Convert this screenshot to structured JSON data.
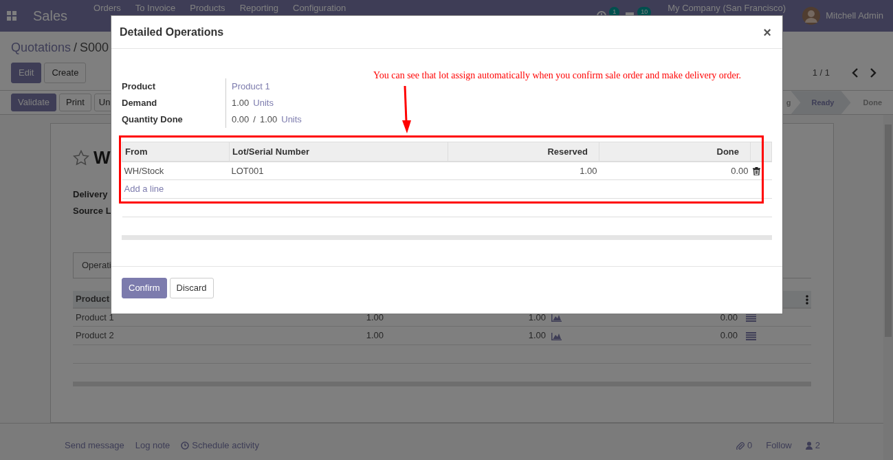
{
  "navbar": {
    "app_title": "Sales",
    "menu": [
      "Orders",
      "To Invoice",
      "Products",
      "Reporting",
      "Configuration"
    ],
    "activity_count": "1",
    "message_count": "10",
    "company": "My Company (San Francisco)",
    "user": "Mitchell Admin"
  },
  "breadcrumb": {
    "parent": "Quotations",
    "separator": "/",
    "current": "S000"
  },
  "control_buttons": [
    {
      "label": "Edit",
      "kind": "primary"
    },
    {
      "label": "Create",
      "kind": "secondary"
    }
  ],
  "pager": "1 / 1",
  "action_buttons": [
    {
      "label": "Validate",
      "kind": "primary"
    },
    {
      "label": "Print",
      "kind": "secondary"
    },
    {
      "label": "Un",
      "kind": "secondary"
    }
  ],
  "status_steps": [
    {
      "label": "g",
      "selected": false
    },
    {
      "label": "Ready",
      "selected": true
    },
    {
      "label": "Done",
      "selected": false
    }
  ],
  "sheet": {
    "starred": false,
    "title": "W",
    "fields": [
      "Delivery",
      "Source L"
    ],
    "tab": "Operati",
    "table": {
      "columns": [
        "Product"
      ],
      "rows": [
        {
          "product": "Product 1",
          "demand": "1.00",
          "reserved": "1.00",
          "done": "0.00"
        },
        {
          "product": "Product 2",
          "demand": "1.00",
          "reserved": "1.00",
          "done": "0.00"
        }
      ]
    }
  },
  "chatter": {
    "actions": [
      "Send message",
      "Log note",
      "Schedule activity"
    ],
    "attachments": "0",
    "follow": "Follow",
    "followers": "2"
  },
  "dialog": {
    "title": "Detailed Operations",
    "close": "×",
    "annotation": "You can see that lot assign automatically when you confirm sale order and make delivery order.",
    "fields": [
      {
        "label": "Product",
        "parts": [
          {
            "text": "Product 1",
            "kind": "link"
          }
        ]
      },
      {
        "label": "Demand",
        "parts": [
          {
            "text": "1.00",
            "kind": "plain"
          },
          {
            "text": "Units",
            "kind": "link"
          }
        ]
      },
      {
        "label": "Quantity Done",
        "parts": [
          {
            "text": "0.00",
            "kind": "plain"
          },
          {
            "text": "/",
            "kind": "plain"
          },
          {
            "text": "1.00",
            "kind": "plain"
          },
          {
            "text": "Units",
            "kind": "link"
          }
        ]
      }
    ],
    "table": {
      "columns": [
        "From",
        "Lot/Serial Number",
        "Reserved",
        "Done"
      ],
      "rows": [
        {
          "from": "WH/Stock",
          "lot": "LOT001",
          "reserved": "1.00",
          "done": "0.00"
        }
      ],
      "add_line": "Add a line"
    },
    "buttons": [
      {
        "label": "Confirm",
        "kind": "primary"
      },
      {
        "label": "Discard",
        "kind": "secondary"
      }
    ]
  }
}
